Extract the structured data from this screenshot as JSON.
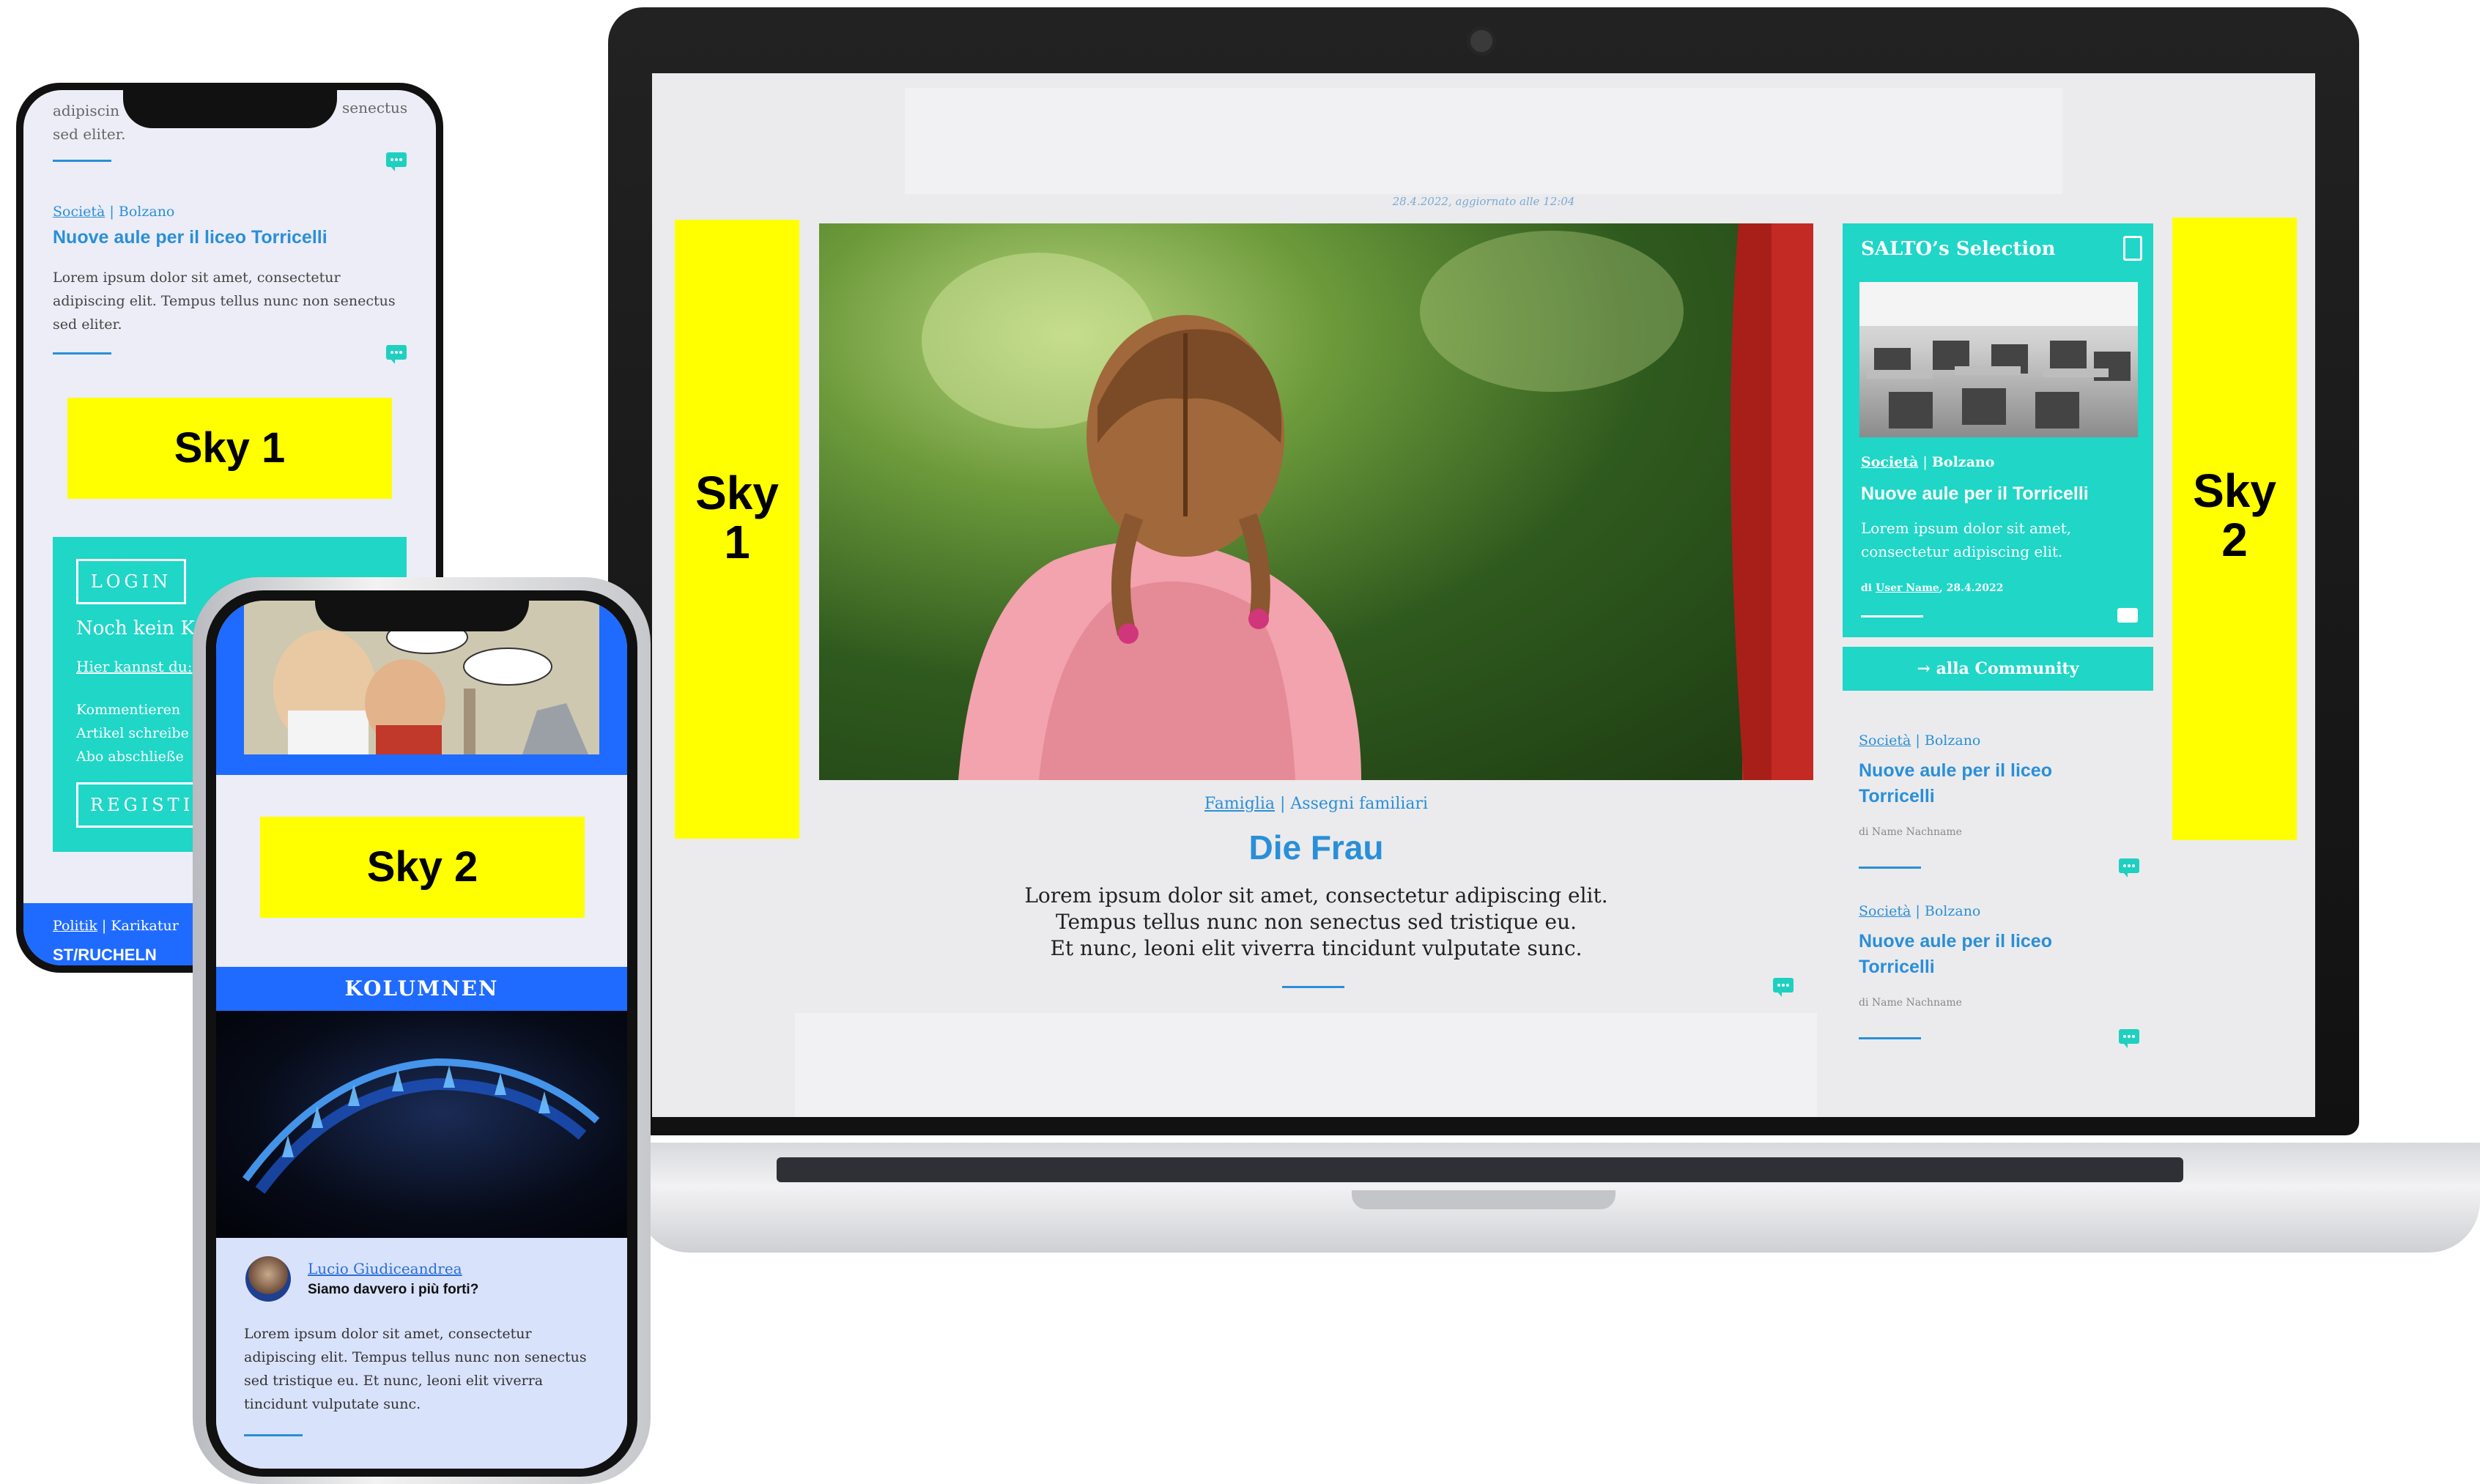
{
  "colors": {
    "accent": "#2a8fd8",
    "teal": "#1fd6c7",
    "sky": "#ffff00",
    "blue_band": "#1f6bff"
  },
  "laptop": {
    "dateline": "28.4.2022, aggiornato alle 12:04",
    "sky_left": [
      "Sky",
      "1"
    ],
    "sky_right": [
      "Sky",
      "2"
    ],
    "main_article": {
      "category": "Famiglia",
      "subcategory": "Assegni familiari",
      "title": "Die Frau",
      "text": [
        "Lorem ipsum dolor sit amet, consectetur adipiscing elit.",
        "Tempus tellus nunc non senectus sed tristique eu.",
        "Et nunc, leoni elit viverra tincidunt vulputate sunc."
      ]
    },
    "selection": {
      "title": "SALTO’s Selection",
      "category": "Società",
      "place": "Bolzano",
      "headline": "Nuove aule per il Torricelli",
      "text": [
        "Lorem ipsum dolor sit amet,",
        "consectetur adipiscing elit."
      ],
      "byline_prefix": "di",
      "byline_user": "User Name",
      "byline_date": "28.4.2022",
      "community_button": "alla Community"
    },
    "side_articles": [
      {
        "category": "Società",
        "place": "Bolzano",
        "headline": [
          "Nuove aule per il liceo",
          "Torricelli"
        ],
        "byline": "di Name Nachname"
      },
      {
        "category": "Società",
        "place": "Bolzano",
        "headline": [
          "Nuove aule per il liceo",
          "Torricelli"
        ],
        "byline": "di Name Nachname"
      }
    ]
  },
  "phone1": {
    "top_text_left": [
      "adipiscin",
      "sed eliter."
    ],
    "top_text_right": "senectus",
    "article": {
      "category": "Società",
      "place": "Bolzano",
      "headline": "Nuove aule per il liceo Torricelli",
      "text": [
        "Lorem ipsum dolor sit amet, consectetur",
        "adipiscing elit. Tempus tellus nunc non senectus",
        "sed eliter."
      ]
    },
    "sky": "Sky 1",
    "login_box": {
      "login_button": "LOGIN",
      "no_account": "Noch kein Ko",
      "here_link": "Hier kannst du:",
      "list": [
        "Kommentieren",
        "Artikel schreibe",
        "Abo abschließe"
      ],
      "register_button": "REGISTI"
    },
    "footer": {
      "category": "Politik",
      "subcategory": "Karikatur",
      "partial": "ST/RUCHELN"
    }
  },
  "phone2": {
    "cartoon_bubbles": [
      "",
      ""
    ],
    "sky": "Sky 2",
    "kolumnen": "KOLUMNEN",
    "author": {
      "name": "Lucio Giudiceandrea",
      "headline": "Siamo davvero i più forti?",
      "text": [
        "Lorem ipsum dolor sit amet, consectetur",
        "adipiscing elit. Tempus tellus nunc non senectus",
        "sed tristique eu. Et nunc, leoni elit viverra",
        "tincidunt vulputate sunc."
      ]
    }
  }
}
